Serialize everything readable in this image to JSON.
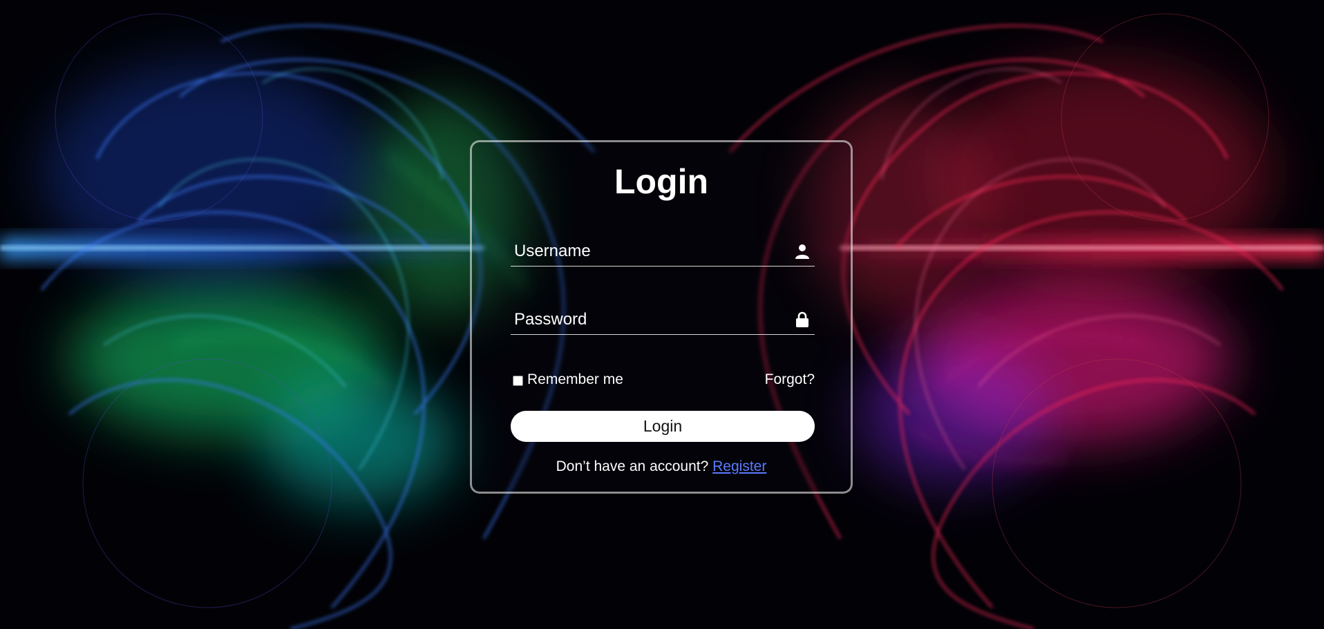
{
  "login_form": {
    "title": "Login",
    "username": {
      "placeholder": "Username",
      "value": "",
      "icon": "user-icon"
    },
    "password": {
      "placeholder": "Password",
      "value": "",
      "icon": "lock-icon"
    },
    "remember_label": "Remember me",
    "remember_checked": false,
    "forgot_label": "Forgot?",
    "submit_label": "Login",
    "register_prompt": "Don’t have an account?",
    "register_link": "Register"
  },
  "colors": {
    "link": "#5b7bff",
    "card_border": "#c8c8c8",
    "background": "#020206",
    "left_glow": "#2f7bff",
    "right_glow": "#ff2a6a",
    "green_glow": "#19e36a"
  }
}
